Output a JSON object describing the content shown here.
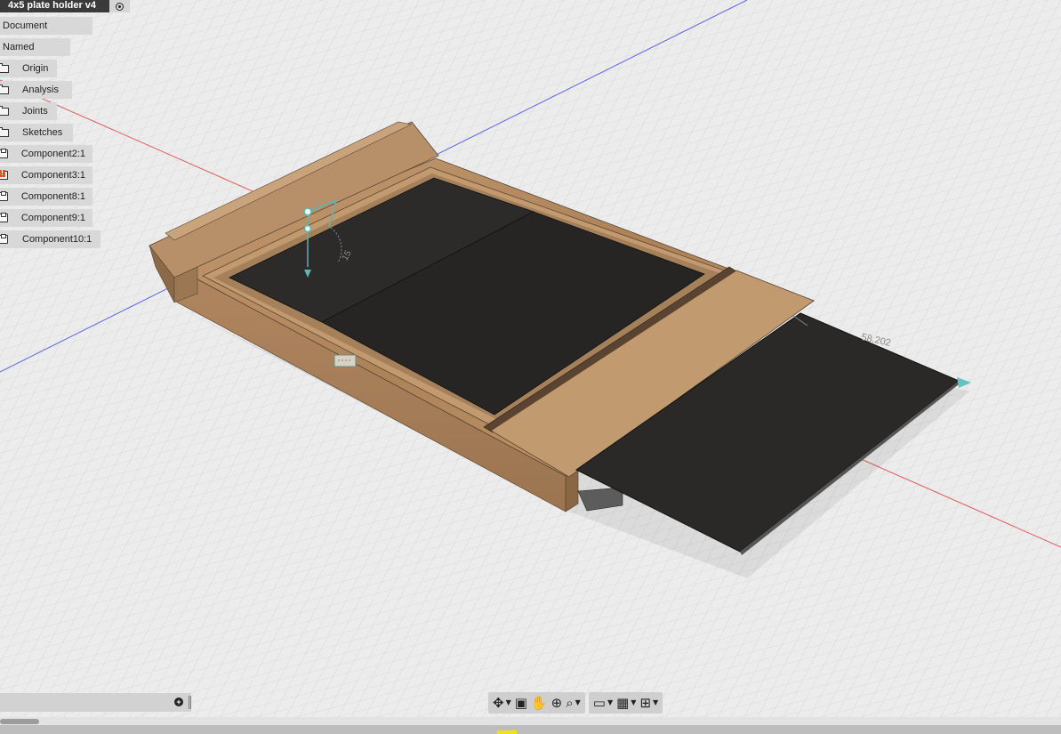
{
  "document": {
    "title": "4x5 plate holder v4"
  },
  "browser": {
    "settings_label": "Document Settings",
    "named_views_label": "Named Views",
    "items": [
      {
        "label": "Origin",
        "icon": "folder-icon"
      },
      {
        "label": "Analysis",
        "icon": "folder-icon"
      },
      {
        "label": "Joints",
        "icon": "folder-icon"
      },
      {
        "label": "Sketches",
        "icon": "folder-icon"
      },
      {
        "label": "Component2:1",
        "icon": "component-icon"
      },
      {
        "label": "Component3:1",
        "icon": "component-warning-icon"
      },
      {
        "label": "Component8:1",
        "icon": "component-icon"
      },
      {
        "label": "Component9:1",
        "icon": "component-icon"
      },
      {
        "label": "Component10:1",
        "icon": "component-icon"
      }
    ]
  },
  "canvas": {
    "dimension_value": "58.202",
    "angle_value": "15"
  },
  "comments": {
    "add_icon": "plus-circle-icon"
  },
  "navbar": {
    "tools": [
      {
        "name": "orbit-tool",
        "glyph": "✥",
        "has_caret": true
      },
      {
        "name": "look-at-tool",
        "glyph": "▣",
        "has_caret": false
      },
      {
        "name": "pan-tool",
        "glyph": "✋",
        "has_caret": false
      },
      {
        "name": "zoom-tool",
        "glyph": "⊕",
        "has_caret": false
      },
      {
        "name": "fit-tool",
        "glyph": "⌕",
        "has_caret": true
      }
    ],
    "display": [
      {
        "name": "display-settings",
        "glyph": "▭",
        "has_caret": true
      },
      {
        "name": "grid-settings",
        "glyph": "▦",
        "has_caret": true
      },
      {
        "name": "viewports-settings",
        "glyph": "⊞",
        "has_caret": true
      }
    ]
  },
  "colors": {
    "grid_bg": "#e9e9ea",
    "wood": "#b48a62",
    "wood_dark": "#8f6b48",
    "plate": "#2b2b2b",
    "x_axis": "#e05050",
    "z_axis": "#5060e0",
    "accent": "#f2e01a"
  }
}
